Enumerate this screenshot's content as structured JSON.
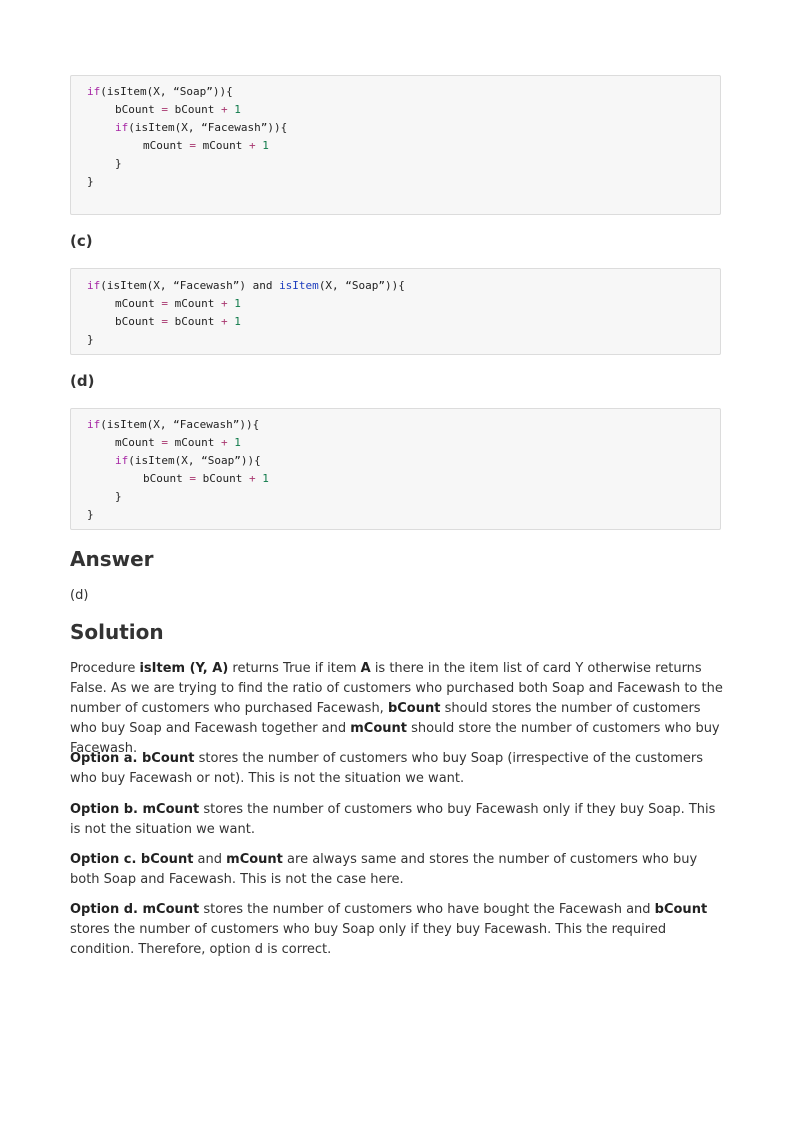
{
  "code_blocks": {
    "b": {
      "l1": {
        "a": "if",
        "b": "(isItem(X, “Soap”)){"
      },
      "l2": {
        "a": "bCount ",
        "b": "=",
        "c": " bCount ",
        "d": "+",
        "e": " 1"
      },
      "l3": {
        "a": "if",
        "b": "(isItem(X, “Facewash”)){"
      },
      "l4": {
        "a": "mCount ",
        "b": "=",
        "c": " mCount ",
        "d": "+",
        "e": " 1"
      },
      "l5": "}",
      "l6": "}"
    },
    "c": {
      "l1": {
        "a": "if",
        "b": "(isItem(X, “Facewash”) and ",
        "c": "isItem",
        "d": "(X, “Soap”)){"
      },
      "l2": {
        "a": "mCount ",
        "b": "=",
        "c": " mCount ",
        "d": "+",
        "e": " 1"
      },
      "l3": {
        "a": "bCount ",
        "b": "=",
        "c": " bCount ",
        "d": "+",
        "e": " 1"
      },
      "l4": "}"
    },
    "d": {
      "l1": {
        "a": "if",
        "b": "(isItem(X, “Facewash”)){"
      },
      "l2": {
        "a": "mCount ",
        "b": "=",
        "c": " mCount ",
        "d": "+",
        "e": " 1"
      },
      "l3": {
        "a": "if",
        "b": "(isItem(X, “Soap”)){"
      },
      "l4": {
        "a": "bCount ",
        "b": "=",
        "c": " bCount ",
        "d": "+",
        "e": " 1"
      },
      "l5": "}",
      "l6": "}"
    }
  },
  "labels": {
    "c": "(c)",
    "d": "(d)"
  },
  "answer": {
    "heading": "Answer",
    "value": "(d)"
  },
  "solution": {
    "heading": "Solution",
    "p1": {
      "t1": "Procedure ",
      "b1": "isItem (Y, A)",
      "t2": " returns True if item ",
      "b2": "A",
      "t3": " is there in the item list of card Y otherwise returns False. As we are trying to find the ratio of customers who purchased both Soap and Facewash to the number of customers who purchased Facewash, ",
      "b3": "bCount",
      "t4": " should stores the number of customers who buy Soap and Facewash together and ",
      "b4": "mCount",
      "t5": " should store the number of customers who buy Facewash."
    },
    "p2": {
      "b1": "Option a. bCount",
      "t1": " stores the number of customers who buy Soap (irrespective of the customers who buy Facewash or not). This is not the situation we want."
    },
    "p3": {
      "b1": "Option b. mCount",
      "t1": " stores the number of customers who buy Facewash only if they buy Soap. This is not the situation we want."
    },
    "p4": {
      "b1": "Option c. bCount",
      "t1": " and ",
      "b2": "mCount",
      "t2": " are always same and stores the number of customers who buy both Soap and Facewash. This is not the case here."
    },
    "p5": {
      "b1": "Option d. mCount",
      "t1": " stores the number of customers who have bought the Facewash and ",
      "b2": "bCount",
      "t2": " stores the number of customers who buy Soap only if they buy Facewash. This the required condition. Therefore, option d is correct."
    }
  }
}
